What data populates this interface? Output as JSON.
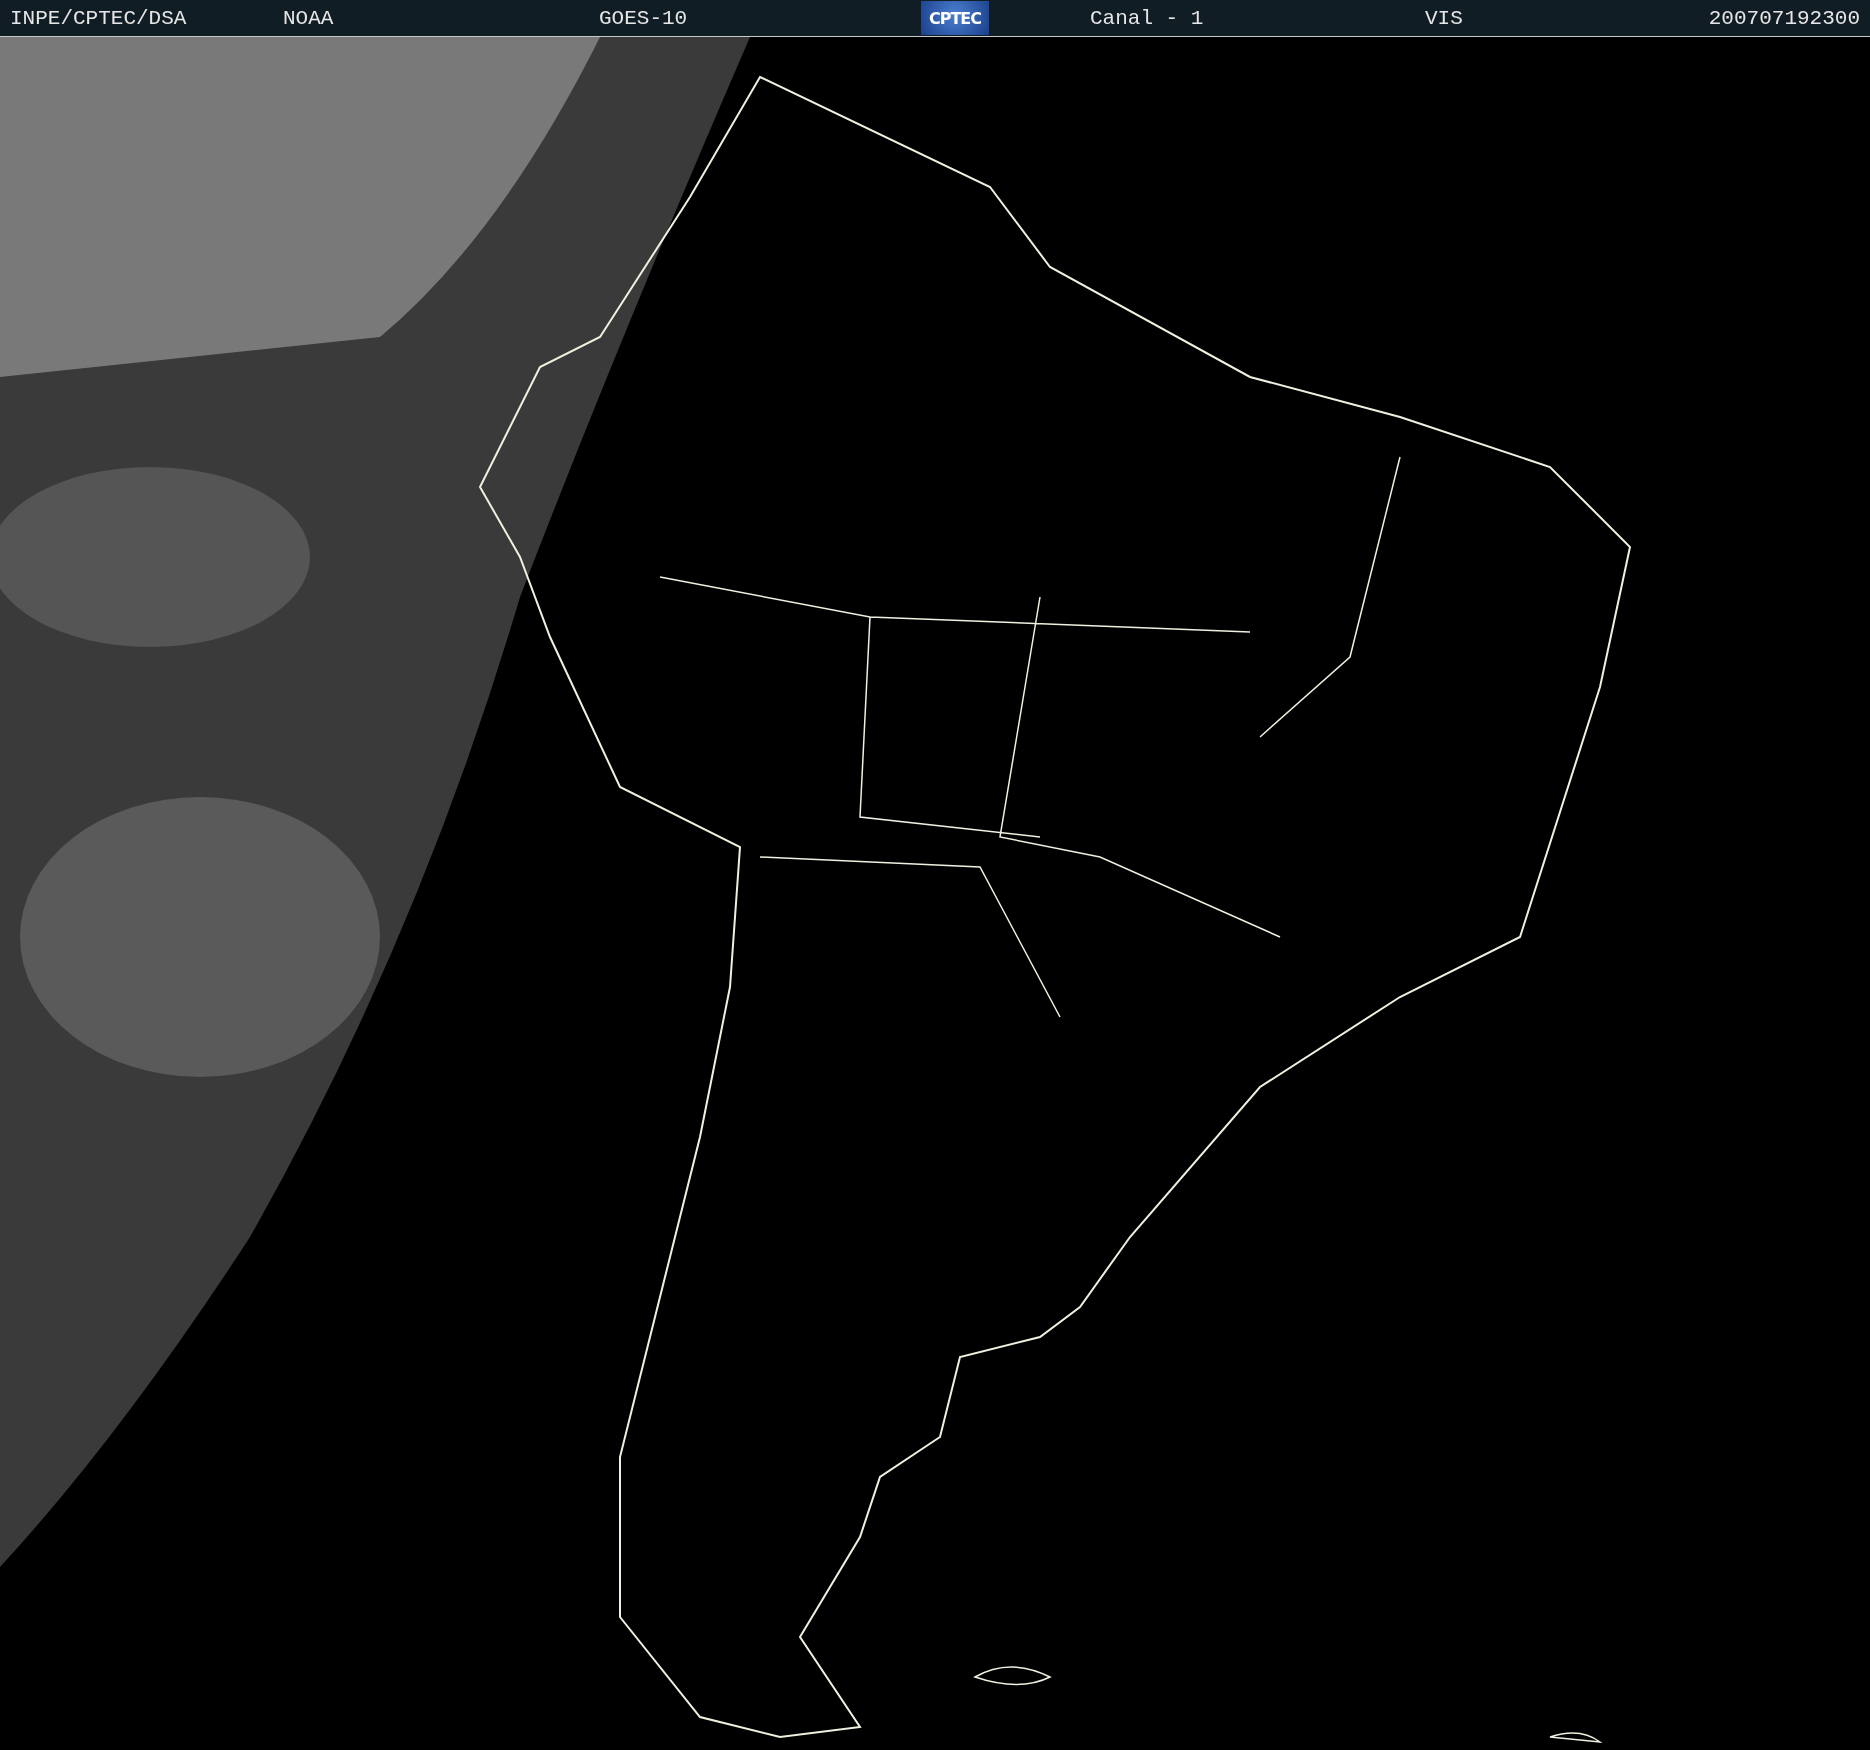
{
  "header": {
    "source": "INPE/CPTEC/DSA",
    "agency": "NOAA",
    "satellite": "GOES-10",
    "logo": "CPTEC",
    "channel": "Canal - 1",
    "band": "VIS",
    "timestamp": "200707192300"
  }
}
